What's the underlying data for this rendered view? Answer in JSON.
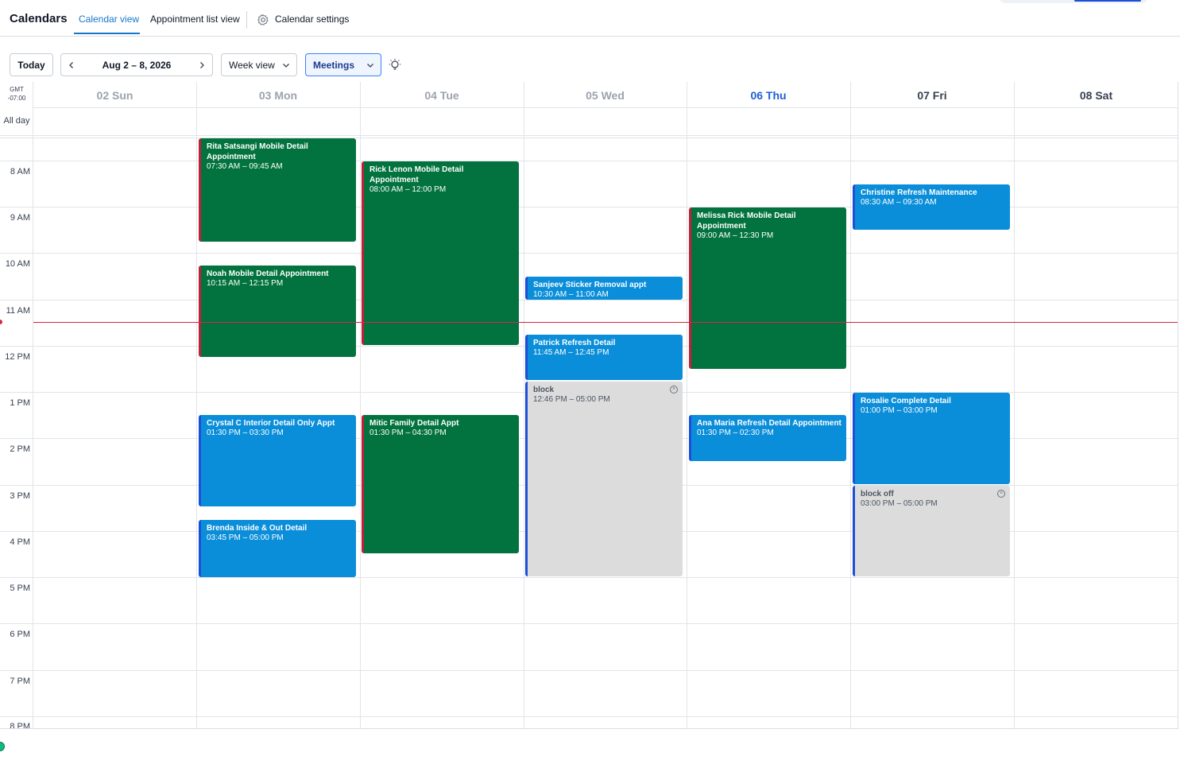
{
  "header": {
    "title": "Calendars",
    "tabs": [
      {
        "label": "Calendar view"
      },
      {
        "label": "Appointment list view"
      }
    ],
    "settings_label": "Calendar settings"
  },
  "toolbar": {
    "today_label": "Today",
    "date_range": "Aug 2 – 8, 2026",
    "view_select": "Week view",
    "calendar_select": "Meetings"
  },
  "grid": {
    "timezone_line1": "GMT",
    "timezone_line2": "-07:00",
    "allday_label": "All day",
    "days": [
      {
        "label": "02 Sun"
      },
      {
        "label": "03 Mon"
      },
      {
        "label": "04 Tue"
      },
      {
        "label": "05 Wed"
      },
      {
        "label": "06 Thu"
      },
      {
        "label": "07 Fri"
      },
      {
        "label": "08 Sat"
      }
    ],
    "hours": [
      "8 AM",
      "9 AM",
      "10 AM",
      "11 AM",
      "12 PM",
      "1 PM",
      "2 PM",
      "3 PM",
      "4 PM",
      "5 PM",
      "6 PM",
      "7 PM",
      "8 PM"
    ]
  },
  "events": [
    {
      "title": "Rita Satsangi Mobile Detail Appointment",
      "time": "07:30 AM – 09:45 AM",
      "color": "green"
    },
    {
      "title": "Noah Mobile Detail Appointment",
      "time": "10:15 AM – 12:15 PM",
      "color": "green"
    },
    {
      "title": "Crystal C Interior Detail Only Appt",
      "time": "01:30 PM – 03:30 PM",
      "color": "blue"
    },
    {
      "title": "Brenda Inside & Out Detail",
      "time": "03:45 PM – 05:00 PM",
      "color": "blue"
    },
    {
      "title": "Rick Lenon Mobile Detail Appointment",
      "time": "08:00 AM – 12:00 PM",
      "color": "green"
    },
    {
      "title": "Mitic Family Detail Appt",
      "time": "01:30 PM – 04:30 PM",
      "color": "green"
    },
    {
      "title": "Sanjeev Sticker Removal appt",
      "time": "10:30 AM – 11:00 AM",
      "color": "blue"
    },
    {
      "title": "Patrick Refresh Detail",
      "time": "11:45 AM – 12:45 PM",
      "color": "blue"
    },
    {
      "title": "block",
      "time": "12:46 PM – 05:00 PM",
      "color": "gray"
    },
    {
      "title": "Melissa Rick Mobile Detail Appointment",
      "time": "09:00 AM – 12:30 PM",
      "color": "green"
    },
    {
      "title": "Ana Maria Refresh Detail Appointment",
      "time": "01:30 PM – 02:30 PM",
      "color": "blue"
    },
    {
      "title": "Christine Refresh Maintenance",
      "time": "08:30 AM – 09:30 AM",
      "color": "blue"
    },
    {
      "title": "Rosalie Complete Detail",
      "time": "01:00 PM – 03:00 PM",
      "color": "blue"
    },
    {
      "title": "block off",
      "time": "03:00 PM – 05:00 PM",
      "color": "gray"
    }
  ],
  "colors": {
    "accent": "#1677c9",
    "today": "#1d5fd6",
    "event_green": "#02733e",
    "event_blue": "#0a8ed9",
    "event_gray": "#dcdcdc",
    "now_line": "#d1284a"
  }
}
